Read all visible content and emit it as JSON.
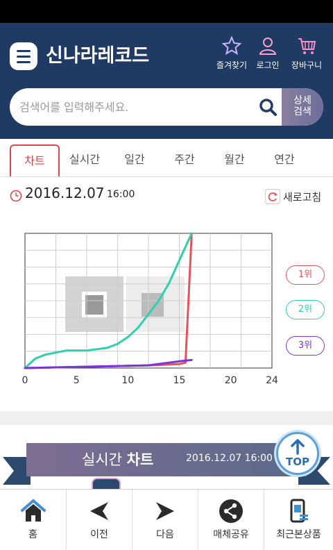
{
  "header": {
    "logo": "신나라레코드",
    "favorites_label": "즐겨찾기",
    "login_label": "로그인",
    "cart_label": "장바구니"
  },
  "search": {
    "placeholder": "검색어를 입력해주세요.",
    "detail_line1": "상세",
    "detail_line2": "검색"
  },
  "tabs": [
    {
      "label": "차트",
      "active": true
    },
    {
      "label": "실시간"
    },
    {
      "label": "일간"
    },
    {
      "label": "주간"
    },
    {
      "label": "월간"
    },
    {
      "label": "연간"
    }
  ],
  "timestamp": {
    "date": "2016.12.07",
    "time": "16:00"
  },
  "refresh_label": "새로고침",
  "chart_data": {
    "type": "line",
    "title": "",
    "xlabel": "",
    "ylabel": "",
    "xlim": [
      0,
      24
    ],
    "x_ticks": [
      "0",
      "5",
      "10",
      "15",
      "20",
      "24"
    ],
    "ylim": [
      0,
      100
    ],
    "grid": true,
    "legend_placement": "right",
    "series": [
      {
        "name": "1위",
        "color": "#e8505a",
        "x": [
          0,
          3,
          6,
          9,
          12,
          15,
          15.6,
          16.2
        ],
        "y": [
          0,
          0.5,
          1,
          1.5,
          2,
          3,
          4,
          100
        ]
      },
      {
        "name": "2위",
        "color": "#2ecfb0",
        "x": [
          0,
          1,
          2,
          4,
          6,
          8,
          9,
          10,
          11,
          12,
          13,
          14,
          15,
          16.2
        ],
        "y": [
          0,
          7,
          10,
          13,
          13,
          15,
          18,
          23,
          30,
          40,
          50,
          63,
          80,
          100
        ]
      },
      {
        "name": "3위",
        "color": "#7a35d8",
        "x": [
          0,
          3,
          6,
          9,
          12,
          14,
          15,
          16.2
        ],
        "y": [
          0,
          0.5,
          1,
          1.5,
          2,
          4,
          5,
          6
        ]
      }
    ]
  },
  "banner": {
    "title_prefix": "실시간",
    "title_bold": "차트",
    "date": "2016.12.07 16:00",
    "top_label": "TOP"
  },
  "bottom_nav": [
    {
      "label": "홈",
      "icon": "home-icon"
    },
    {
      "label": "이전",
      "icon": "back-arrow-icon"
    },
    {
      "label": "다음",
      "icon": "forward-arrow-icon"
    },
    {
      "label": "매체공유",
      "icon": "share-icon"
    },
    {
      "label": "최근본상품",
      "icon": "recent-items-icon"
    }
  ],
  "colors": {
    "header_bg": "#1f3a63",
    "accent_red": "#e0454d",
    "banner_from": "#7d6e93",
    "banner_to": "#5a6a8a"
  }
}
